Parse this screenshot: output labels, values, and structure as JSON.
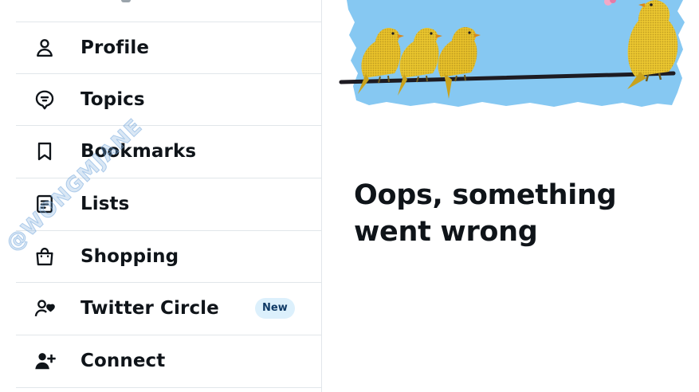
{
  "menu": {
    "items": [
      {
        "label": "Profile",
        "icon": "person-icon"
      },
      {
        "label": "Topics",
        "icon": "topics-icon"
      },
      {
        "label": "Bookmarks",
        "icon": "bookmark-icon"
      },
      {
        "label": "Lists",
        "icon": "lists-icon"
      },
      {
        "label": "Shopping",
        "icon": "shopping-bag-icon"
      },
      {
        "label": "Twitter Circle",
        "icon": "circle-heart-icon",
        "badge": "New"
      },
      {
        "label": "Connect",
        "icon": "add-person-icon"
      }
    ]
  },
  "error": {
    "title": "Oops, something went wrong"
  },
  "watermark": "@WONGMJANE",
  "colors": {
    "text": "#0f1419",
    "divider": "#e1e6ea",
    "badge_bg": "#dcf0fc",
    "sky": "#86c8f2",
    "canary": "#e9c22b"
  }
}
